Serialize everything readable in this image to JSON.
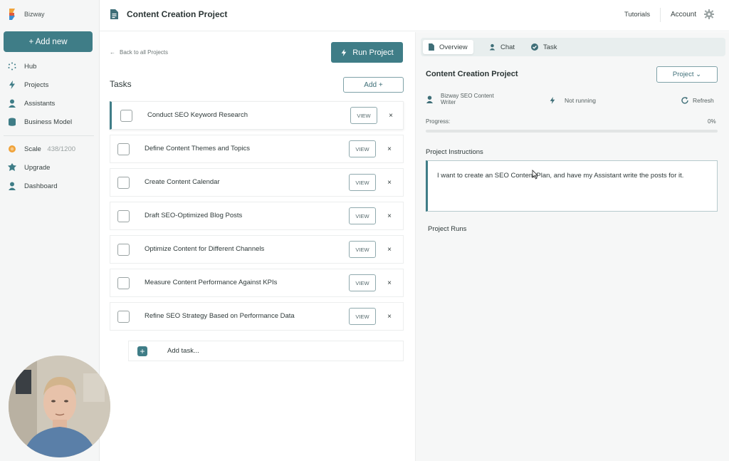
{
  "app": {
    "brand": "Bizway"
  },
  "sidebar": {
    "add_new": "+ Add new",
    "items": [
      {
        "label": "Hub",
        "icon": "hub-icon"
      },
      {
        "label": "Projects",
        "icon": "bolt-icon"
      },
      {
        "label": "Assistants",
        "icon": "assistant-icon"
      },
      {
        "label": "Business Model",
        "icon": "database-icon"
      }
    ],
    "scale": {
      "label": "Scale",
      "count": "438/1200"
    },
    "items2": [
      {
        "label": "Upgrade",
        "icon": "upgrade-icon"
      },
      {
        "label": "Dashboard",
        "icon": "user-icon"
      }
    ]
  },
  "header": {
    "title": "Content Creation Project",
    "tutorials": "Tutorials",
    "account": "Account"
  },
  "tasks_panel": {
    "back_link": "Back to all Projects",
    "run_button": "Run Project",
    "title": "Tasks",
    "add_button": "Add  +",
    "view_label": "VIEW",
    "delete_label": "×",
    "add_task": "Add task...",
    "tasks": [
      "Conduct SEO Keyword Research",
      "Define Content Themes and Topics",
      "Create Content Calendar",
      "Draft SEO-Optimized Blog Posts",
      "Optimize Content for Different Channels",
      "Measure Content Performance Against KPIs",
      "Refine SEO Strategy Based on Performance Data"
    ]
  },
  "details": {
    "tabs": [
      "Overview",
      "Chat",
      "Task"
    ],
    "project_title": "Content Creation Project",
    "project_dropdown": "Project  ⌄",
    "assistant_name": "Bizway SEO Content Writer",
    "status": "Not running",
    "refresh": "Refresh",
    "progress_label": "Progress:",
    "progress_value": "0%",
    "progress_fraction": 0,
    "instructions_title": "Project Instructions",
    "instructions_text": "I want to create an SEO Content Plan, and have my Assistant write the posts for it.",
    "runs_title": "Project Runs"
  },
  "colors": {
    "accent": "#3f7d87",
    "brand_orange": "#f0a33a",
    "brand_blue": "#3b8fd4"
  }
}
